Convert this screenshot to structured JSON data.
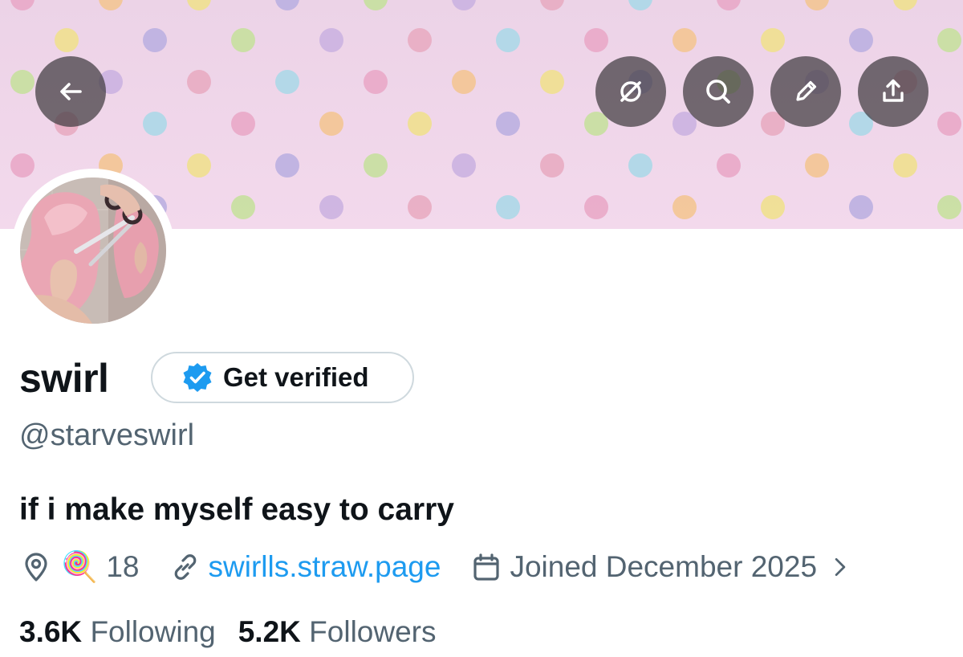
{
  "header": {
    "back_icon": "arrow-left-icon",
    "grok_icon": "grok-icon",
    "search_icon": "search-icon",
    "edit_icon": "pencil-icon",
    "share_icon": "share-icon"
  },
  "profile": {
    "display_name": "swirl",
    "verify_label": "Get verified",
    "handle": "@starveswirl",
    "bio": "if i make myself easy to carry",
    "location": "🍭 18",
    "website": "swirlls.straw.page",
    "joined": "Joined December 2025"
  },
  "stats": {
    "following_count": "3.6K",
    "following_label": "Following",
    "followers_count": "5.2K",
    "followers_label": "Followers"
  },
  "colors": {
    "accent": "#1d9bf0",
    "text_primary": "#0f1419",
    "text_secondary": "#536471",
    "banner": "#f0d6ea"
  }
}
